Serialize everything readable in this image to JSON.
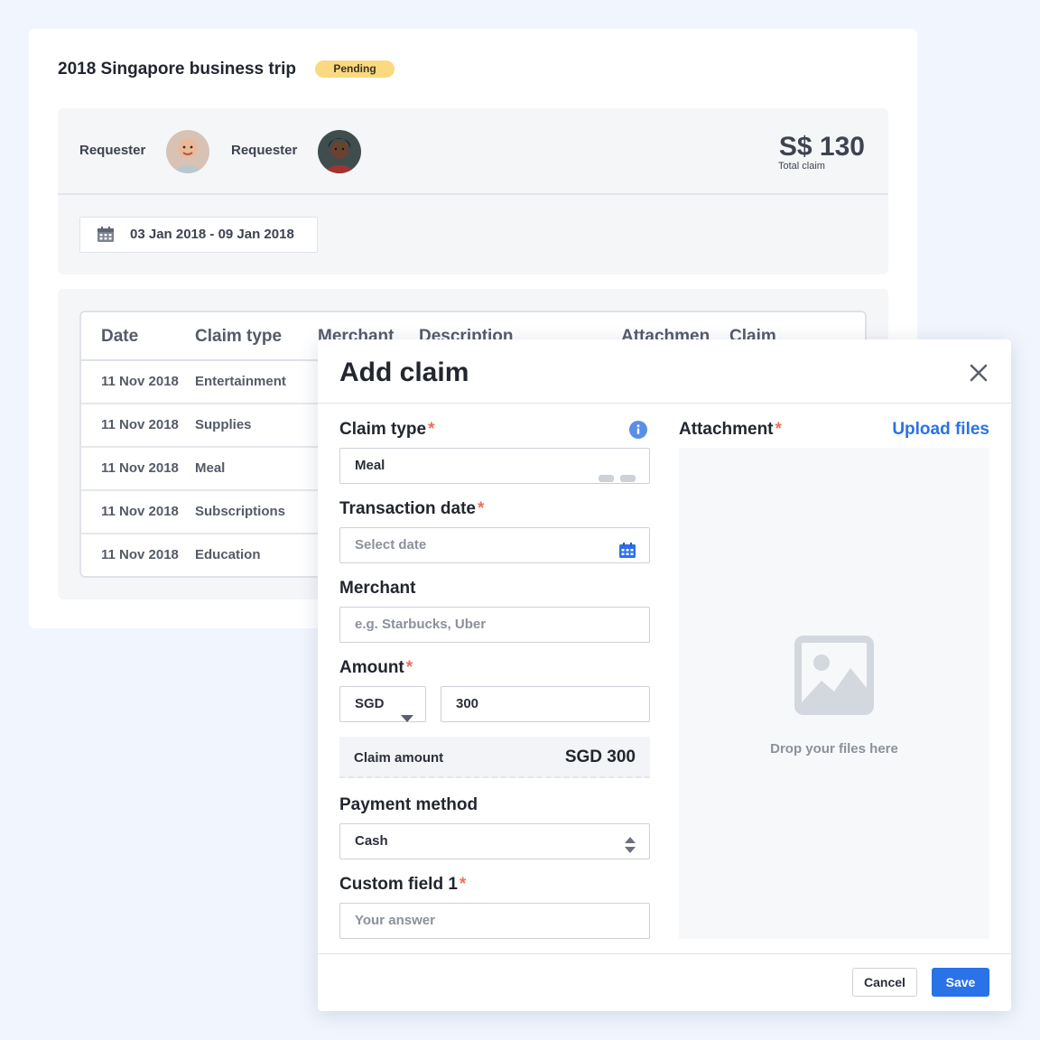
{
  "trip": {
    "title": "2018 Singapore business trip",
    "status": "Pending",
    "requester_label_1": "Requester",
    "requester_label_2": "Requester",
    "total_amount": "S$ 130",
    "total_label": "Total claim",
    "date_range": "03 Jan 2018 - 09 Jan 2018"
  },
  "table": {
    "headers": [
      "Date",
      "Claim type",
      "Merchant",
      "Description",
      "Attachmen",
      "Claim"
    ],
    "rows": [
      {
        "date": "11 Nov 2018",
        "type": "Entertainment"
      },
      {
        "date": "11 Nov 2018",
        "type": "Supplies"
      },
      {
        "date": "11 Nov 2018",
        "type": "Meal"
      },
      {
        "date": "11 Nov 2018",
        "type": "Subscriptions"
      },
      {
        "date": "11 Nov 2018",
        "type": "Education"
      }
    ]
  },
  "modal": {
    "title": "Add claim",
    "claim_type": {
      "label": "Claim type",
      "value": "Meal"
    },
    "transaction_date": {
      "label": "Transaction date",
      "placeholder": "Select date"
    },
    "merchant": {
      "label": "Merchant",
      "placeholder": "e.g. Starbucks, Uber"
    },
    "amount": {
      "label": "Amount",
      "currency": "SGD",
      "value": "300"
    },
    "claim_amount": {
      "label": "Claim amount",
      "value": "SGD 300"
    },
    "payment_method": {
      "label": "Payment method",
      "value": "Cash"
    },
    "custom_field": {
      "label": "Custom field 1",
      "placeholder": "Your answer"
    },
    "attachment": {
      "label": "Attachment",
      "upload_link": "Upload files",
      "drop_text": "Drop your files here"
    },
    "buttons": {
      "cancel": "Cancel",
      "save": "Save"
    },
    "required_marker": "*"
  },
  "colors": {
    "accent": "#2a72e8",
    "badge": "#fbd980",
    "required": "#ef6f5c",
    "background": "#f1f5fd"
  },
  "icons": [
    "calendar-icon",
    "info-icon",
    "close-icon",
    "chevron-down-icon",
    "sort-arrows-icon",
    "image-placeholder-icon"
  ]
}
